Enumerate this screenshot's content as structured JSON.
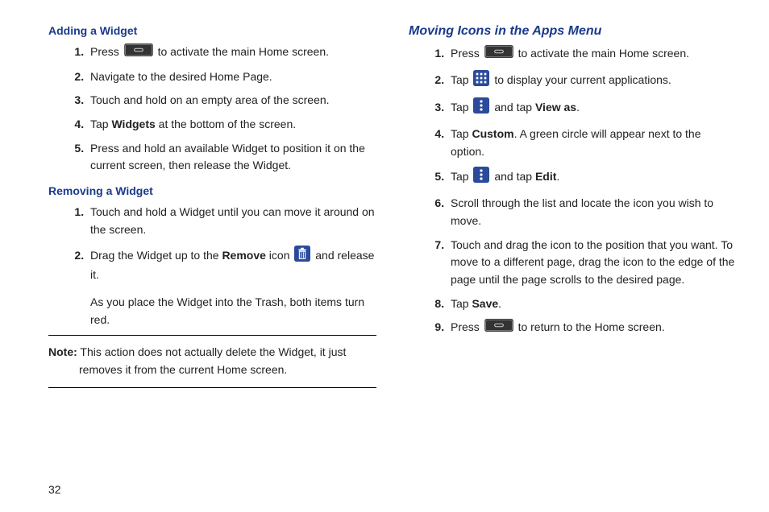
{
  "page_number": "32",
  "left": {
    "section1_title": "Adding a Widget",
    "s1_1a": "Press ",
    "s1_1b": " to activate the main Home screen.",
    "s1_2": "Navigate to the desired Home Page.",
    "s1_3": "Touch and hold on an empty area of the screen.",
    "s1_4a": "Tap ",
    "s1_4b": "Widgets",
    "s1_4c": " at the bottom of the screen.",
    "s1_5": "Press and hold an available Widget to position it on the current screen, then release the Widget.",
    "section2_title": "Removing a Widget",
    "s2_1": "Touch and hold a Widget until you can move it around on the screen.",
    "s2_2a": "Drag the Widget up to the ",
    "s2_2b": "Remove",
    "s2_2c": " icon ",
    "s2_2d": " and release it.",
    "s2_trail": "As you place the Widget into the Trash, both items turn red.",
    "note_label": "Note:",
    "note_body": " This action does not actually delete the Widget, it just removes it from the current Home screen."
  },
  "right": {
    "title": "Moving Icons in the Apps Menu",
    "r1a": "Press ",
    "r1b": " to activate the main Home screen.",
    "r2a": "Tap ",
    "r2b": " to display your current applications.",
    "r3a": "Tap ",
    "r3b": " and tap ",
    "r3c": "View as",
    "r3d": ".",
    "r4a": "Tap ",
    "r4b": "Custom",
    "r4c": ". A green circle will appear next to the option.",
    "r5a": "Tap ",
    "r5b": " and tap ",
    "r5c": "Edit",
    "r5d": ".",
    "r6": "Scroll through the list and locate the icon you wish to move.",
    "r7": "Touch and drag the icon to the position that you want. To move to a different page, drag the icon to the edge of the page until the page scrolls to the desired page.",
    "r8a": "Tap ",
    "r8b": "Save",
    "r8c": ".",
    "r9a": "Press ",
    "r9b": " to return to the Home screen."
  }
}
